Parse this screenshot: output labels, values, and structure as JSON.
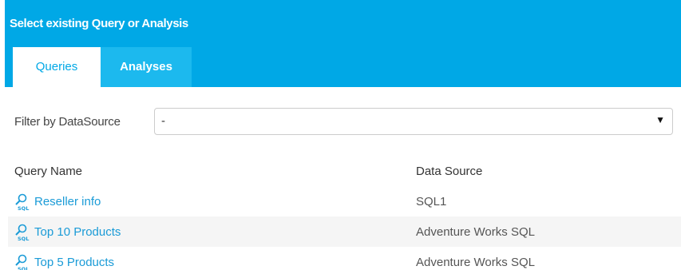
{
  "dialog": {
    "title": "Select existing Query or Analysis"
  },
  "tabs": [
    {
      "label": "Queries",
      "active": true
    },
    {
      "label": "Analyses",
      "active": false
    }
  ],
  "filter": {
    "label": "Filter by DataSource",
    "selected": "-"
  },
  "table": {
    "columns": [
      "Query Name",
      "Data Source"
    ],
    "rows": [
      {
        "name": "Reseller info",
        "source": "SQL1",
        "icon": "sql-query-icon"
      },
      {
        "name": "Top 10 Products",
        "source": "Adventure Works SQL",
        "icon": "sql-query-icon"
      },
      {
        "name": "Top 5 Products",
        "source": "Adventure Works SQL",
        "icon": "sql-query-icon"
      }
    ]
  },
  "colors": {
    "header_bg": "#00a8e6",
    "inactive_tab_bg": "#1cb9ee",
    "link": "#1a9bd7",
    "row_alt_bg": "#f5f5f5"
  }
}
